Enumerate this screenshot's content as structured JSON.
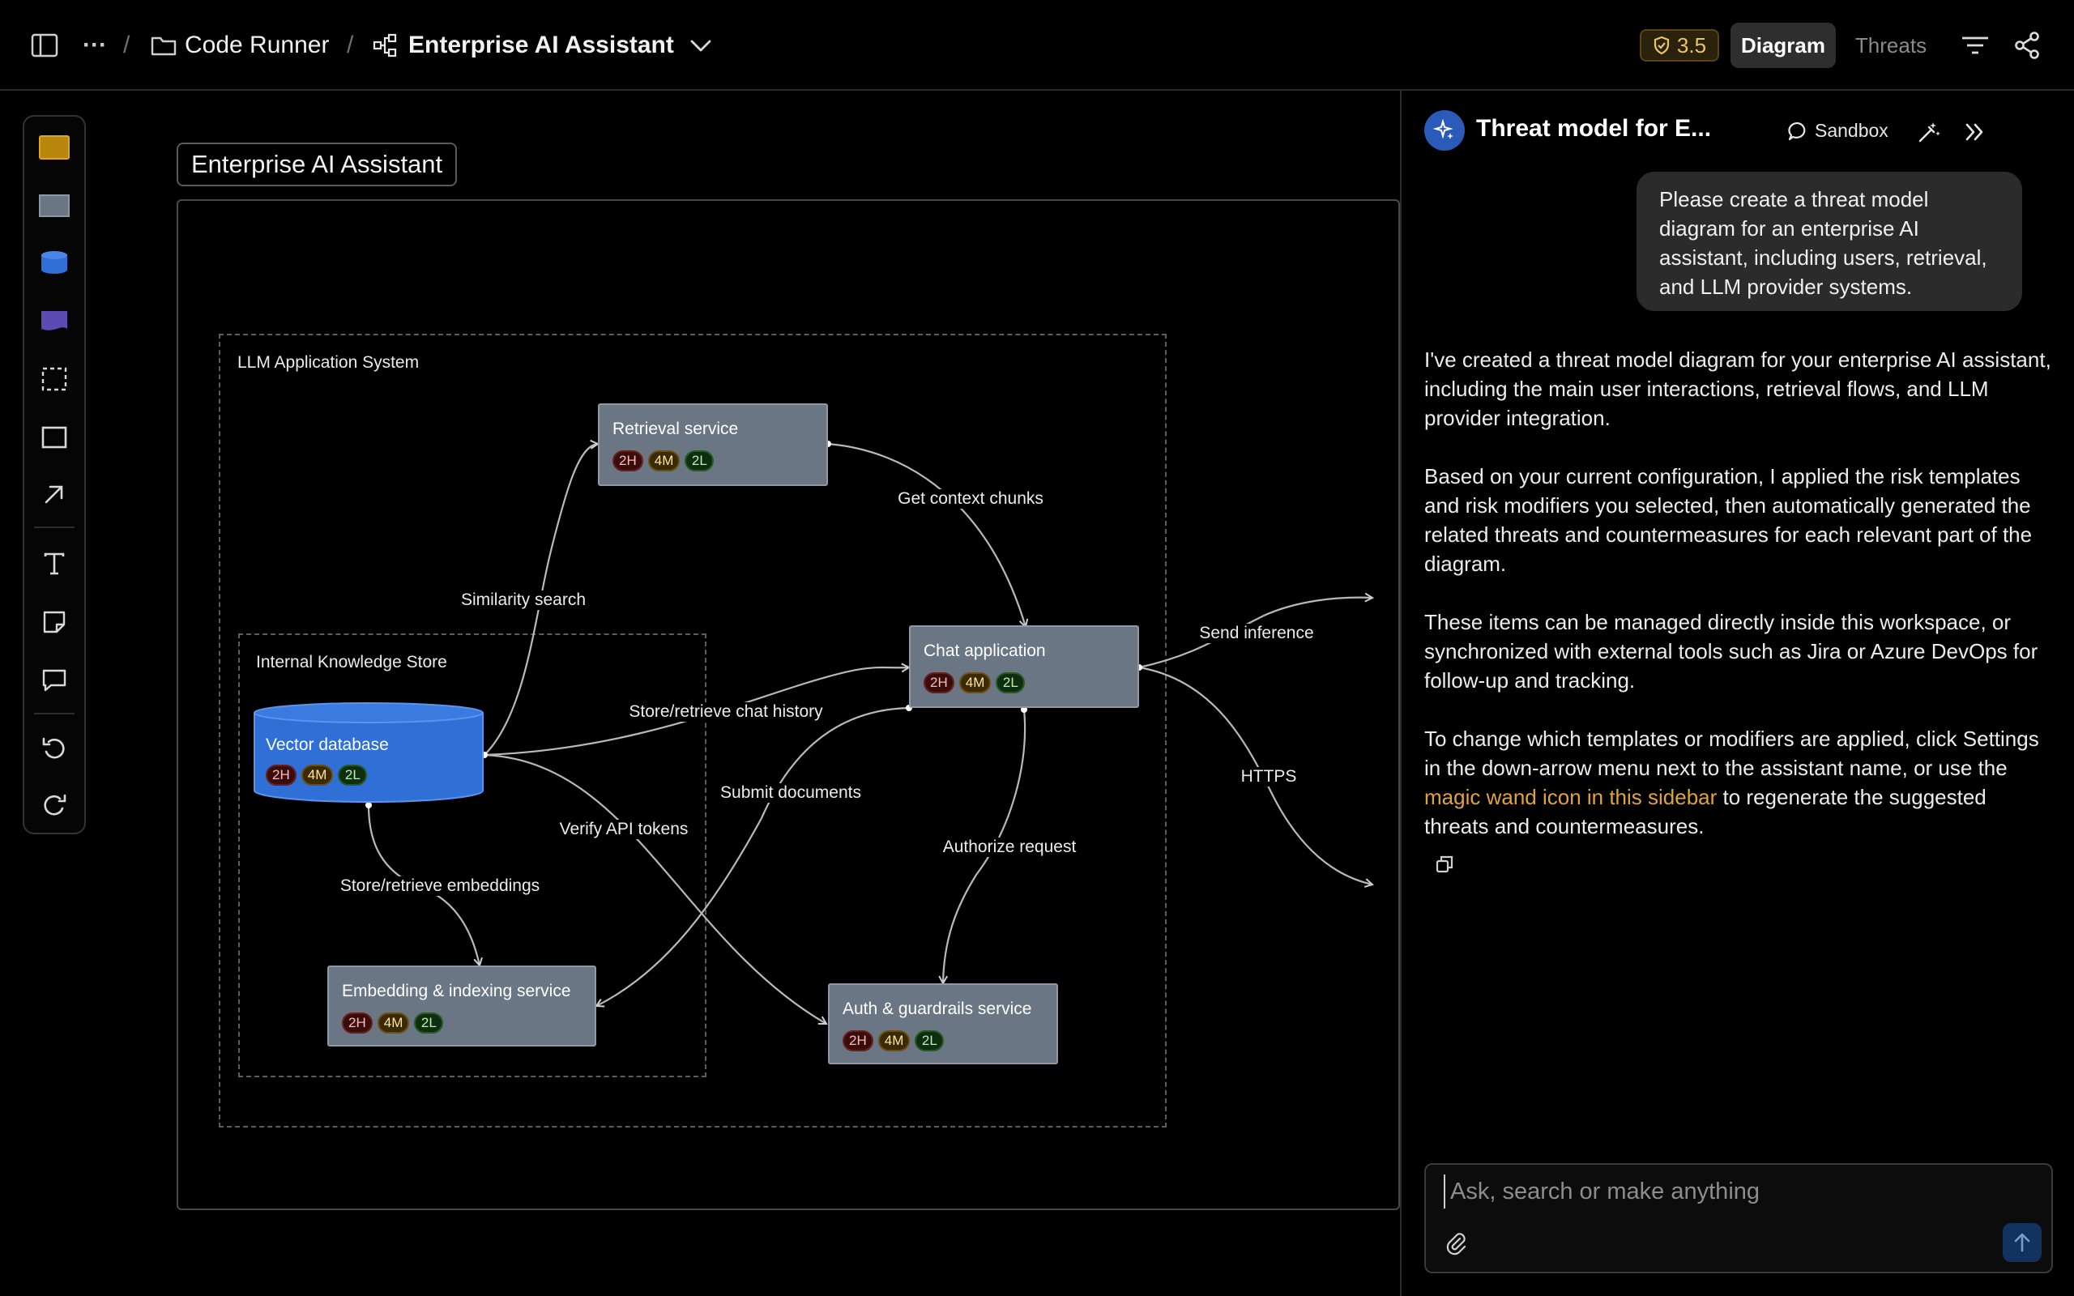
{
  "topbar": {
    "breadcrumb_project": "Code Runner",
    "breadcrumb_diagram": "Enterprise AI Assistant",
    "score": "3.5",
    "tab_diagram": "Diagram",
    "tab_threats": "Threats",
    "sep": "/",
    "more": "···"
  },
  "toolbar": {
    "colors": {
      "process": "#b8860b",
      "external": "#6b7685",
      "store": "#2f6fd6",
      "document": "#5b4bb3"
    }
  },
  "canvas": {
    "frame_title": "Enterprise AI Assistant",
    "boundaries": {
      "llm_app": "LLM Application System",
      "knowledge_store": "Internal Knowledge Store"
    },
    "nodes": {
      "retrieval": {
        "title": "Retrieval service",
        "h": "2H",
        "m": "4M",
        "l": "2L"
      },
      "chat": {
        "title": "Chat  application",
        "h": "2H",
        "m": "4M",
        "l": "2L"
      },
      "vector": {
        "title": "Vector database",
        "h": "2H",
        "m": "4M",
        "l": "2L"
      },
      "embedding": {
        "title": "Embedding & indexing service",
        "h": "2H",
        "m": "4M",
        "l": "2L"
      },
      "auth": {
        "title": "Auth & guardrails service",
        "h": "2H",
        "m": "4M",
        "l": "2L"
      }
    },
    "edges": {
      "similarity": "Similarity search",
      "context": "Get context chunks",
      "chat_history": "Store/retrieve chat history",
      "submit_docs": "Submit documents",
      "verify_tokens": "Verify API tokens",
      "embeddings": "Store/retrieve embeddings",
      "authorize": "Authorize request",
      "inference": "Send inference",
      "https": "HTTPS"
    },
    "colors": {
      "node_fill": "#6b7685",
      "store_fill": "#2f6fd6"
    }
  },
  "panel": {
    "title": "Threat model for E...",
    "sandbox_label": "Sandbox",
    "user_message": "Please create a threat model diagram for an enterprise AI assistant, including users, retrieval, and LLM provider systems.",
    "assistant": {
      "p1": "I've created a threat model diagram for your enterprise AI assistant, including the main user interactions, retrieval flows, and LLM provider integration.",
      "p2": "Based on your current configuration, I applied the risk templates and risk modifiers you selected, then automatically generated the related threats and countermeasures for each relevant part of the diagram.",
      "p3": "These items can be managed directly inside this workspace, or synchronized with external tools such as Jira or Azure DevOps for follow-up and tracking.",
      "p4_a": "To change which templates or modifiers are applied, click Settings in the down-arrow menu next to the assistant name, or use the ",
      "p4_link": "magic wand icon in this sidebar",
      "p4_b": " to regenerate the suggested threats and countermeasures."
    },
    "composer_placeholder": "Ask, search or make anything",
    "accent": "#e0a43a"
  }
}
